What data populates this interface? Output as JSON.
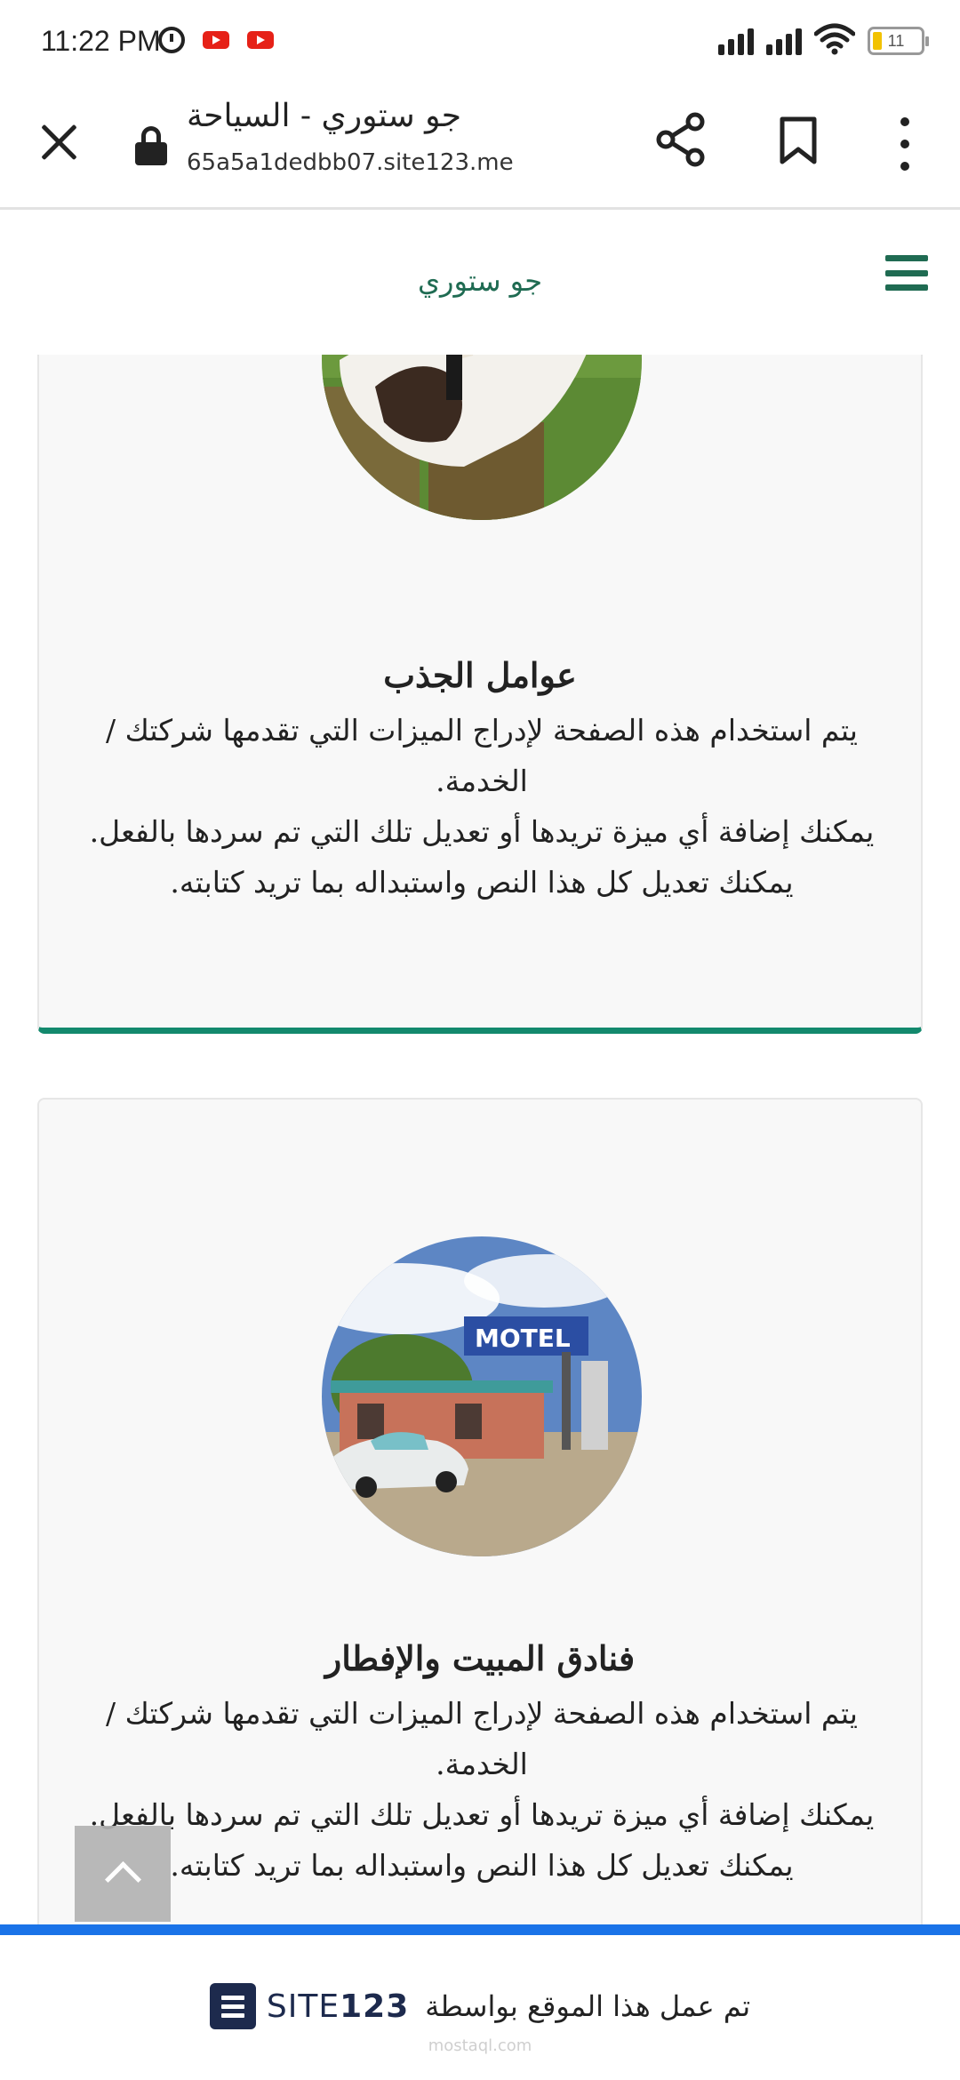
{
  "status_bar": {
    "time": "11:22 PM",
    "battery_level": "11",
    "icons": [
      "alarm-icon",
      "youtube-icon",
      "youtube-icon",
      "signal-icon",
      "signal-icon",
      "wifi-icon",
      "battery-icon"
    ]
  },
  "browser": {
    "page_title": "جو ستوري - السياحة",
    "url": "65a5a1dedbb07.site123.me",
    "icons": [
      "close-icon",
      "lock-icon",
      "share-icon",
      "bookmark-icon",
      "more-vert-icon"
    ]
  },
  "site": {
    "logo_text": "جو ستوري",
    "menu_icon": "hamburger-icon",
    "accent_color": "#1f6b52"
  },
  "cards": [
    {
      "title": "عوامل الجذب",
      "lines": [
        "يتم استخدام هذه الصفحة لإدراج الميزات التي تقدمها شركتك / الخدمة.",
        "يمكنك إضافة أي ميزة تريدها أو تعديل تلك التي تم سردها بالفعل.",
        "يمكنك تعديل كل هذا النص واستبداله بما تريد كتابته."
      ],
      "image": "horse-rider-jumping"
    },
    {
      "title": "فنادق المبيت والإفطار",
      "lines": [
        "يتم استخدام هذه الصفحة لإدراج الميزات التي تقدمها شركتك / الخدمة.",
        "يمكنك إضافة أي ميزة تريدها أو تعديل تلك التي تم سردها بالفعل.",
        "يمكنك تعديل كل هذا النص واستبداله بما تريد كتابته."
      ],
      "image": "motel-with-classic-car",
      "sign_text": "MOTEL"
    }
  ],
  "footer": {
    "built_with": "تم عمل هذا الموقع بواسطة",
    "brand": "SITE",
    "brand_number": "123",
    "watermark": "mostaql.com",
    "bar_color": "#1a73e8"
  }
}
